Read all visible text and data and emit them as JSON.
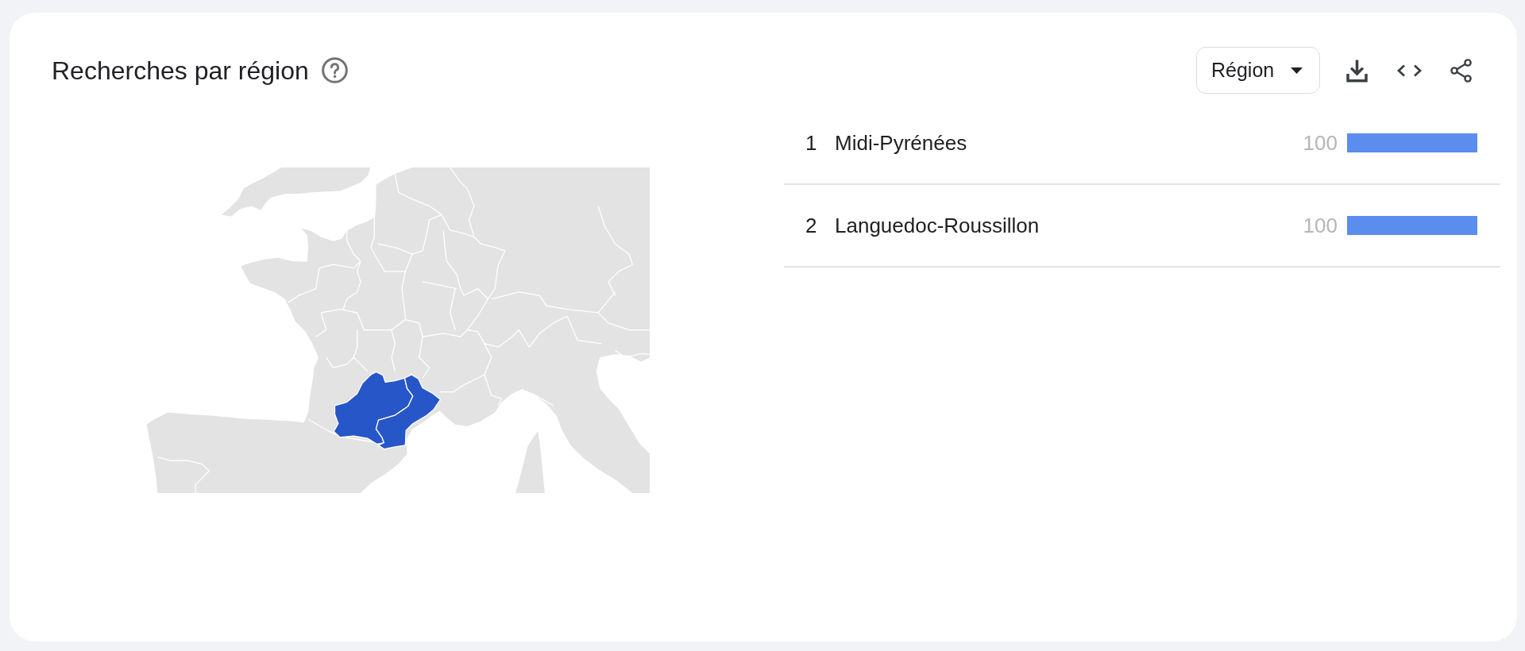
{
  "panel": {
    "title": "Recherches par région",
    "region_select": {
      "value": "Région"
    }
  },
  "regions": [
    {
      "rank": "1",
      "name": "Midi-Pyrénées",
      "score": "100",
      "level": 1
    },
    {
      "rank": "2",
      "name": "Languedoc-Roussillon",
      "score": "100",
      "level": 1
    }
  ]
}
